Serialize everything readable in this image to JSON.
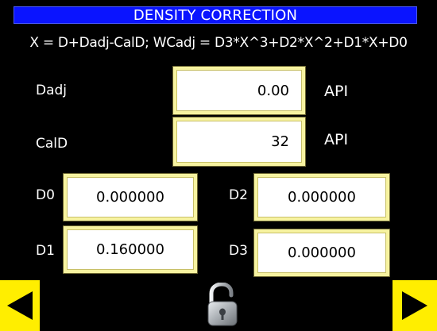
{
  "header": {
    "title": "DENSITY CORRECTION",
    "formula": "X = D+Dadj-CalD; WCadj = D3*X^3+D2*X^2+D1*X+D0"
  },
  "fields": {
    "dadj": {
      "label": "Dadj",
      "value": "0.00",
      "unit": "API"
    },
    "cald": {
      "label": "CalD",
      "value": "32",
      "unit": "API"
    },
    "d0": {
      "label": "D0",
      "value": "0.000000"
    },
    "d1": {
      "label": "D1",
      "value": "0.160000"
    },
    "d2": {
      "label": "D2",
      "value": "0.000000"
    },
    "d3": {
      "label": "D3",
      "value": "0.000000"
    }
  },
  "nav": {
    "prev_icon": "left-arrow-icon",
    "next_icon": "right-arrow-icon",
    "lock_icon": "unlocked-padlock-icon"
  },
  "colors": {
    "background": "#000000",
    "title_bar": "#0a14ff",
    "nav_button": "#ffee00",
    "field_border": "#f7f3a0"
  }
}
